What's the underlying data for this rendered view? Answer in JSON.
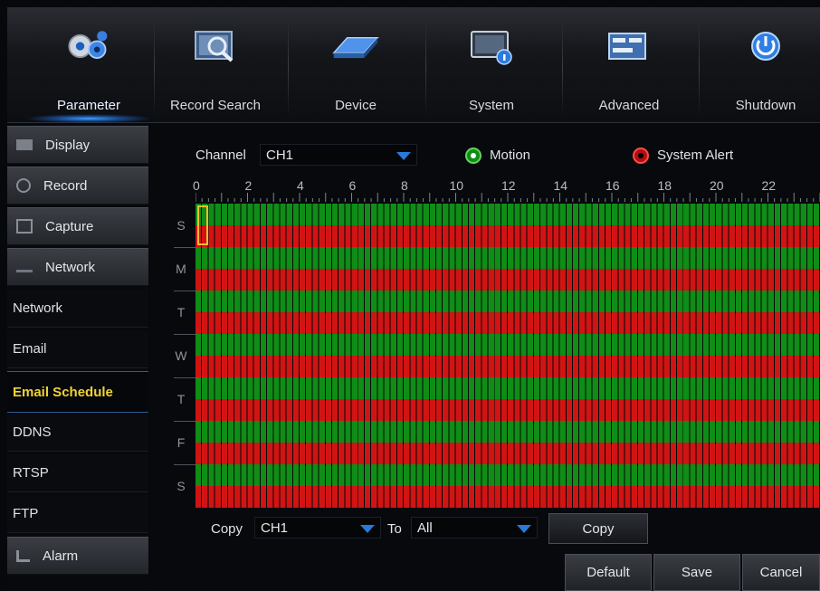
{
  "nav": {
    "items": [
      {
        "label": "Parameter",
        "icon": "gears-icon"
      },
      {
        "label": "Record Search",
        "icon": "record-search-icon"
      },
      {
        "label": "Device",
        "icon": "hard-disk-icon"
      },
      {
        "label": "System",
        "icon": "system-info-icon"
      },
      {
        "label": "Advanced",
        "icon": "advanced-settings-icon"
      },
      {
        "label": "Shutdown",
        "icon": "power-icon"
      }
    ],
    "active": "Parameter"
  },
  "sidebar": {
    "items": [
      {
        "label": "Display",
        "type": "category",
        "icon": "display-icon"
      },
      {
        "label": "Record",
        "type": "category",
        "icon": "record-icon"
      },
      {
        "label": "Capture",
        "type": "category",
        "icon": "capture-icon"
      },
      {
        "label": "Network",
        "type": "category",
        "icon": "network-icon"
      },
      {
        "label": "Network",
        "type": "sub"
      },
      {
        "label": "Email",
        "type": "sub"
      },
      {
        "label": "Email Schedule",
        "type": "sub",
        "selected": true
      },
      {
        "label": "DDNS",
        "type": "sub"
      },
      {
        "label": "RTSP",
        "type": "sub"
      },
      {
        "label": "FTP",
        "type": "sub"
      },
      {
        "label": "Alarm",
        "type": "category",
        "icon": "alarm-icon"
      }
    ]
  },
  "schedule": {
    "channel_label": "Channel",
    "channel_value": "CH1",
    "legend": [
      {
        "label": "Motion",
        "color": "#0f8d17"
      },
      {
        "label": "System Alert",
        "color": "#d01414"
      }
    ],
    "hour_labels": [
      "0",
      "2",
      "4",
      "6",
      "8",
      "10",
      "12",
      "14",
      "16",
      "18",
      "20",
      "22"
    ],
    "days": [
      "S",
      "M",
      "T",
      "W",
      "T",
      "F",
      "S"
    ],
    "rows": {
      "motion_color": "#0f8d17",
      "alert_color": "#d01414"
    }
  },
  "copy_bar": {
    "copy_label": "Copy",
    "from_value": "CH1",
    "to_label": "To",
    "to_value": "All",
    "copy_button": "Copy"
  },
  "footer": {
    "default_button": "Default",
    "save_button": "Save",
    "cancel_button": "Cancel"
  }
}
